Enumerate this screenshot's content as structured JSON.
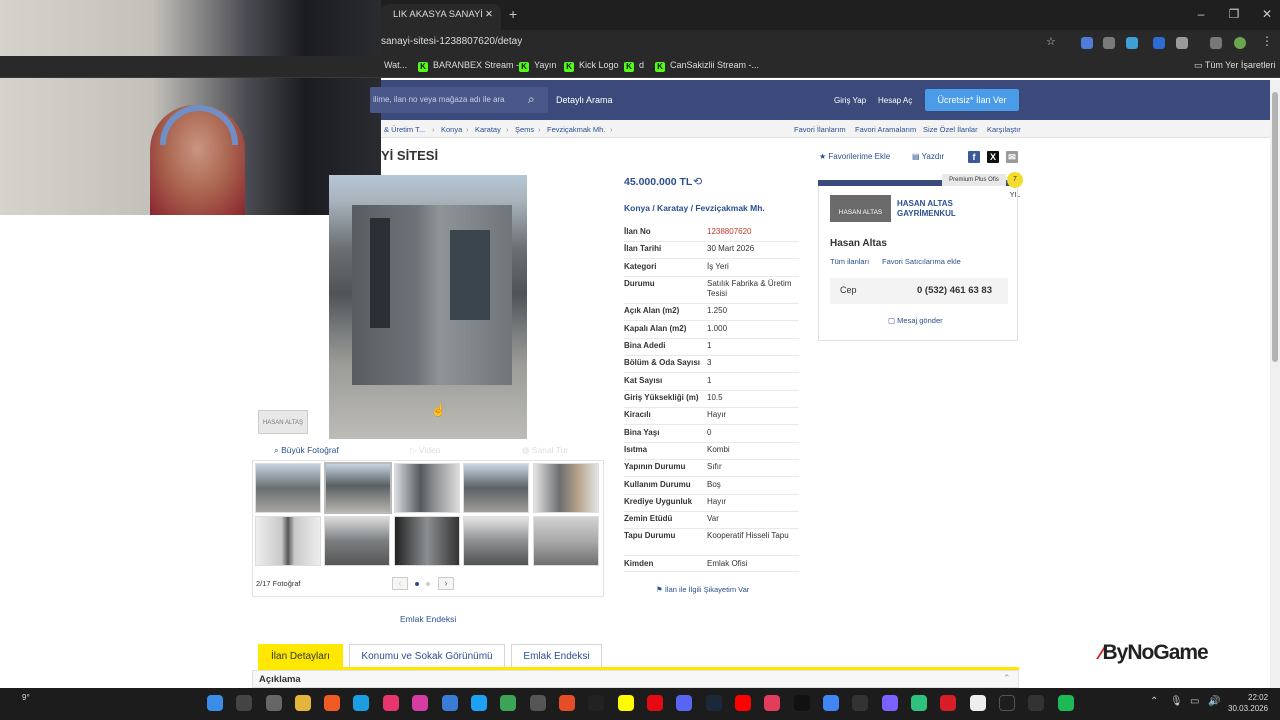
{
  "browser": {
    "tab_title": "LIK AKASYA SANAYİ SİTESİ",
    "url": "sanayi-sitesi-1238807620/detay",
    "bookmarks": [
      "Wat...",
      "BARANBEX Stream -...",
      "Yayın",
      "Kick Logo",
      "d",
      "CanSakizlii Stream -..."
    ],
    "all_bookmarks": "Tüm Yer İşaretleri"
  },
  "site": {
    "search_placeholder": "ilime, ilan no veya mağaza adı ile ara",
    "detailed_search": "Detaylı Arama",
    "login": "Giriş Yap",
    "register": "Hesap Aç",
    "free_ad": "Ücretsiz* İlan Ver"
  },
  "breadcrumb": {
    "items": [
      "& Üretim T...",
      "Konya",
      "Karatay",
      "Şems",
      "Fevziçakmak Mh."
    ],
    "links": [
      "Favori İlanlarım",
      "Favori Aramalarım",
      "Size Özel İlanlar",
      "Karşılaştır"
    ]
  },
  "listing": {
    "title": "Yİ SİTESİ",
    "add_favorite": "Favorilerime Ekle",
    "print": "Yazdır",
    "price": "45.000.000 TL",
    "location": "Konya  /  Karatay  /  Fevziçakmak Mh.",
    "details": [
      {
        "label": "İlan No",
        "value": "1238807620",
        "highlight": true
      },
      {
        "label": "İlan Tarihi",
        "value": "30 Mart 2026"
      },
      {
        "label": "Kategori",
        "value": "İş Yeri"
      },
      {
        "label": "Durumu",
        "value": "Satılık Fabrika & Üretim Tesisi"
      },
      {
        "label": "Açık Alan (m2)",
        "value": "1.250"
      },
      {
        "label": "Kapalı Alan (m2)",
        "value": "1.000"
      },
      {
        "label": "Bina Adedi",
        "value": "1"
      },
      {
        "label": "Bölüm & Oda Sayısı",
        "value": "3"
      },
      {
        "label": "Kat Sayısı",
        "value": "1"
      },
      {
        "label": "Giriş Yüksekliği (m)",
        "value": "10.5"
      },
      {
        "label": "Kiracılı",
        "value": "Hayır"
      },
      {
        "label": "Bina Yaşı",
        "value": "0"
      },
      {
        "label": "Isıtma",
        "value": "Kombi"
      },
      {
        "label": "Yapının Durumu",
        "value": "Sıfır"
      },
      {
        "label": "Kullanım Durumu",
        "value": "Boş"
      },
      {
        "label": "Krediye Uygunluk",
        "value": "Hayır"
      },
      {
        "label": "Zemin Etüdü",
        "value": "Var"
      },
      {
        "label": "Tapu Durumu",
        "value": "Kooperatif Hisseli Tapu"
      },
      {
        "label": "Kimden",
        "value": "Emlak Ofisi"
      }
    ],
    "complaint": "İlan ile İlgili Şikayetim Var"
  },
  "photos": {
    "big_photo": "Büyük Fotoğraf",
    "video": "Video",
    "virtual_tour": "Sanal Tur",
    "count": "2/17 Fotoğraf",
    "endeksi": "Emlak Endeksi",
    "watermark": "HASAN ALTAŞ"
  },
  "seller": {
    "premium": "Premium Plus Ofis",
    "badge": "7 YIL",
    "firm": "HASAN ALTAS GAYRİMENKUL",
    "logo": "HASAN ALTAS",
    "name": "Hasan Altas",
    "all_ads": "Tüm ilanları",
    "fav_seller": "Favori Satıcılarıma ekle",
    "phone_label": "Cep",
    "phone": "0 (532) 461 63 83",
    "message": "Mesaj gönder"
  },
  "tabs": [
    "İlan Detayları",
    "Konumu ve Sokak Görünümü",
    "Emlak Endeksi"
  ],
  "description_header": "Açıklama",
  "overlay": {
    "brand": "ByNoGame"
  },
  "taskbar": {
    "weather": "9°",
    "time": "22:02",
    "date": "30.03.2026"
  }
}
